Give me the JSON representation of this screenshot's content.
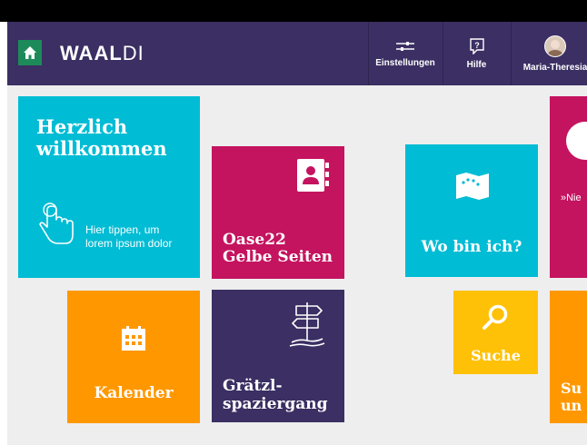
{
  "app": {
    "logo_bold": "WAAL",
    "logo_rest": "DI"
  },
  "header": {
    "settings_label": "Einstellungen",
    "help_label": "Hilfe",
    "user_name": "Maria-Theresia"
  },
  "tiles": {
    "welcome": {
      "title_line1": "Herzlich",
      "title_line2": "willkommen",
      "hint_line1": "Hier tippen, um",
      "hint_line2": "lorem ipsum dolor"
    },
    "gelbe": {
      "line1": "Oase22",
      "line2": "Gelbe Seiten"
    },
    "wo": {
      "label": "Wo bin ich?"
    },
    "pink_cut": {
      "text": "»Nie"
    },
    "kalender": {
      "label": "Kalender"
    },
    "graetzl": {
      "line1": "Grätzl-",
      "line2": "spaziergang"
    },
    "suche": {
      "label": "Suche"
    },
    "orange_cut": {
      "line1": "Su",
      "line2": "un"
    }
  },
  "colors": {
    "header": "#3b2f63",
    "home_button": "#1d8a5a",
    "cyan": "#00bcd4",
    "magenta": "#c4145f",
    "orange": "#ff9800",
    "yellow": "#ffc107",
    "background": "#eeeeee"
  },
  "icons": {
    "home": "home-icon",
    "settings": "sliders-icon",
    "help": "help-icon",
    "avatar": "avatar",
    "tap": "hand-pointer-icon",
    "contacts": "address-book-icon",
    "map": "map-icon",
    "calendar": "calendar-icon",
    "signpost": "signpost-icon",
    "search": "search-icon"
  }
}
